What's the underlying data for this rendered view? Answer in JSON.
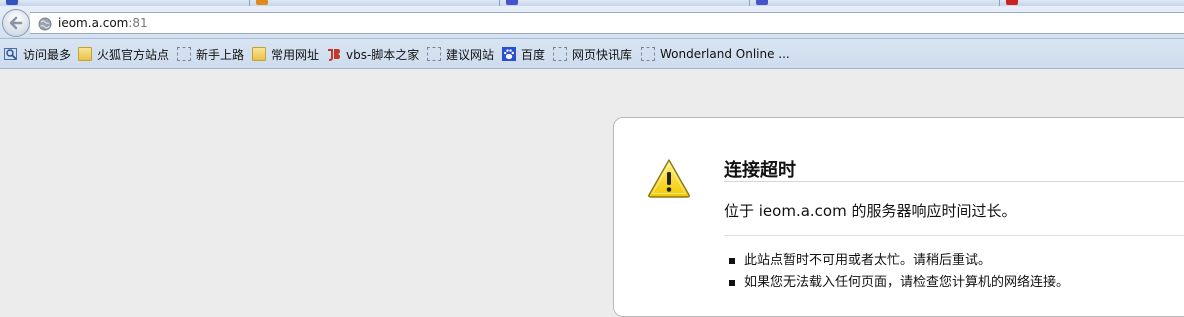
{
  "colors": {
    "tab_icon_1": "#3355bb",
    "tab_icon_2": "#e08a1e",
    "tab_icon_3": "#4455cc",
    "tab_icon_4": "#cc2222"
  },
  "navbar": {
    "url_host": "ieom.a.com",
    "url_port": ":81"
  },
  "bookmarks": {
    "items": [
      {
        "label": "访问最多",
        "icon": "most-visited-icon"
      },
      {
        "label": "火狐官方站点",
        "icon": "folder-icon"
      },
      {
        "label": "新手上路",
        "icon": "blank-page-icon"
      },
      {
        "label": "常用网址",
        "icon": "folder-icon"
      },
      {
        "label": "vbs-脚本之家",
        "icon": "jb51-logo-icon"
      },
      {
        "label": "建议网站",
        "icon": "blank-page-icon"
      },
      {
        "label": "百度",
        "icon": "baidu-paw-icon"
      },
      {
        "label": "网页快讯库",
        "icon": "blank-page-icon"
      },
      {
        "label": "Wonderland Online ...",
        "icon": "blank-page-icon"
      }
    ]
  },
  "error": {
    "title": "连接超时",
    "description": "位于 ieom.a.com 的服务器响应时间过长。",
    "bullets": [
      "此站点暂时不可用或者太忙。请稍后重试。",
      "如果您无法载入任何页面，请检查您计算机的网络连接。"
    ]
  }
}
